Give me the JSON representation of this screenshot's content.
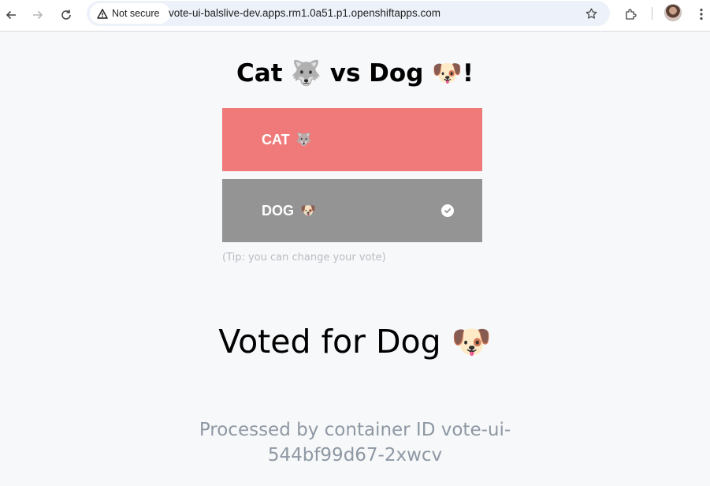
{
  "browser": {
    "security_label": "Not secure",
    "url": "vote-ui-balslive-dev.apps.rm1.0a51.p1.openshiftapps.com"
  },
  "page": {
    "title_cat": "Cat",
    "title_vs_dog": "vs Dog",
    "title_end": "!",
    "cat_emoji": "🐺",
    "dog_emoji": "🐶",
    "cat_button_label": "CAT",
    "dog_button_label": "DOG",
    "selected_option": "DOG",
    "tip": "(Tip: you can change your vote)",
    "voted_text": "Voted for Dog",
    "processed_text": "Processed by container ID vote-ui-544bf99d67-2xwcv"
  },
  "colors": {
    "cat_button": "#f07a7a",
    "dog_button": "#949494",
    "page_background": "#f7f8fa"
  }
}
